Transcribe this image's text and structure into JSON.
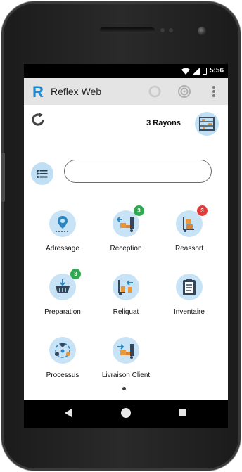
{
  "status_bar": {
    "time": "5:56"
  },
  "app_bar": {
    "logo_letter": "R",
    "title": "Reflex Web",
    "icons": [
      "sync-icon",
      "target-icon",
      "more-vert-icon"
    ]
  },
  "header": {
    "rayons_label": "3 Rayons"
  },
  "search": {
    "value": "",
    "placeholder": ""
  },
  "tiles": [
    {
      "label": "Adressage",
      "icon": "location-pin-icon",
      "badge": ""
    },
    {
      "label": "Reception",
      "icon": "truck-receive-icon",
      "badge": "3",
      "badge_color": "#2fa84f"
    },
    {
      "label": "Reassort",
      "icon": "hand-truck-icon",
      "badge": "3",
      "badge_color": "#e23b3b"
    },
    {
      "label": "Preparation",
      "icon": "basket-icon",
      "badge": "3",
      "badge_color": "#2fa84f"
    },
    {
      "label": "Reliquat",
      "icon": "return-trolley-icon",
      "badge": ""
    },
    {
      "label": "Inventaire",
      "icon": "clipboard-icon",
      "badge": ""
    },
    {
      "label": "Processus",
      "icon": "process-people-icon",
      "badge": ""
    },
    {
      "label": "Livraison Client",
      "icon": "delivery-truck-icon",
      "badge": ""
    }
  ],
  "colors": {
    "accent": "#1e88d2",
    "tile_bg": "#c7e3f5",
    "badge_green": "#2fa84f",
    "badge_red": "#e23b3b"
  }
}
